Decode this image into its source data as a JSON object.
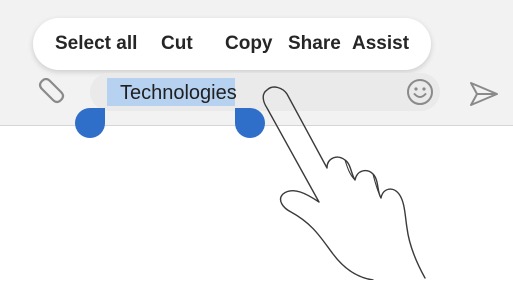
{
  "context_menu": {
    "items": [
      {
        "label": "Select all"
      },
      {
        "label": "Cut"
      },
      {
        "label": "Copy"
      },
      {
        "label": "Share"
      },
      {
        "label": "Assist"
      }
    ]
  },
  "composer": {
    "text": "Technologies",
    "selected_text": "Technologies",
    "icons": {
      "attach": "paperclip-icon",
      "emoji": "emoji-icon",
      "send": "send-icon"
    }
  },
  "colors": {
    "selection_highlight": "#b7d2f0",
    "selection_handle": "#2f6fc9",
    "menu_background": "#ffffff",
    "screen_background": "#f2f2f2"
  }
}
